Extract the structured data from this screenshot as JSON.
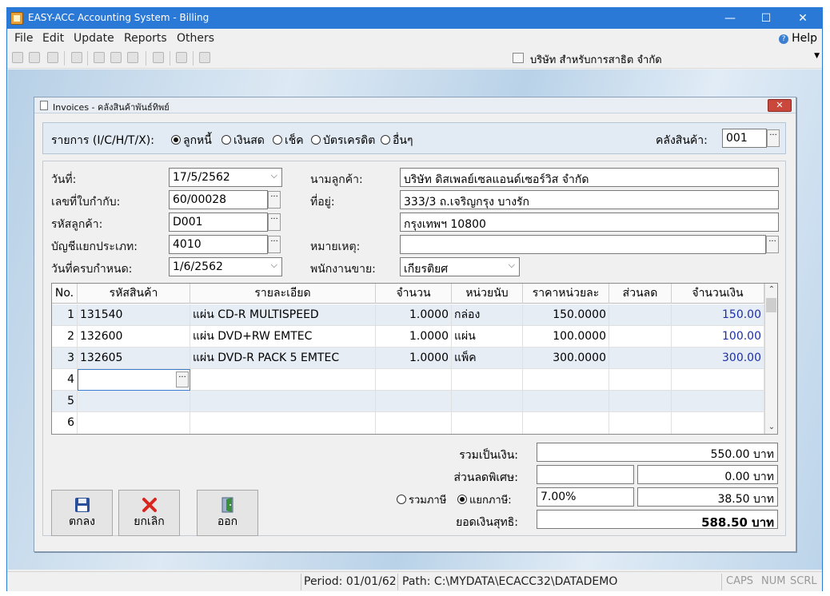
{
  "window": {
    "title": "EASY-ACC Accounting System - Billing",
    "minimize": "—",
    "maximize": "☐",
    "close": "✕"
  },
  "menu": {
    "file": "File",
    "edit": "Edit",
    "update": "Update",
    "reports": "Reports",
    "others": "Others",
    "help": "Help"
  },
  "toolbar": {
    "company": "บริษัท สำหรับการสาธิต จำกัด"
  },
  "dialog": {
    "title": "Invoices - คลังสินค้าพันธ์ทิพย์",
    "type_label": "รายการ (I/C/H/T/X):",
    "types": [
      {
        "label": "ลูกหนี้",
        "selected": true
      },
      {
        "label": "เงินสด",
        "selected": false
      },
      {
        "label": "เช็ค",
        "selected": false
      },
      {
        "label": "บัตรเครดิต",
        "selected": false
      },
      {
        "label": "อื่นๆ",
        "selected": false
      }
    ],
    "warehouse_label": "คลังสินค้า:",
    "warehouse": "001"
  },
  "form": {
    "date_label": "วันที่:",
    "date": "17/5/2562",
    "invoice_label": "เลขที่ใบกำกับ:",
    "invoice": "60/00028",
    "customer_code_label": "รหัสลูกค้า:",
    "customer_code": "D001",
    "account_label": "บัญชีแยกประเภท:",
    "account": "4010",
    "due_label": "วันที่ครบกำหนด:",
    "due": "1/6/2562",
    "customer_name_label": "นามลูกค้า:",
    "customer_name": "บริษัท ดิสเพลย์เซลแอนด์เซอร์วิส จำกัด",
    "address_label": "ที่อยู่:",
    "address1": "333/3 ถ.เจริญกรุง บางรัก",
    "address2": "กรุงเทพฯ 10800",
    "remark_label": "หมายเหตุ:",
    "remark": "",
    "salesman_label": "พนักงานขาย:",
    "salesman": "เกียรติยศ"
  },
  "grid": {
    "headers": [
      "No.",
      "รหัสสินค้า",
      "รายละเอียด",
      "จำนวน",
      "หน่วยนับ",
      "ราคาหน่วยละ",
      "ส่วนลด",
      "จำนวนเงิน"
    ],
    "rows": [
      {
        "no": "1",
        "code": "131540",
        "desc": "แผ่น CD-R MULTISPEED",
        "qty": "1.0000",
        "unit": "กล่อง",
        "price": "150.0000",
        "disc": "",
        "amount": "150.00"
      },
      {
        "no": "2",
        "code": "132600",
        "desc": "แผ่น DVD+RW EMTEC",
        "qty": "1.0000",
        "unit": "แผ่น",
        "price": "100.0000",
        "disc": "",
        "amount": "100.00"
      },
      {
        "no": "3",
        "code": "132605",
        "desc": "แผ่น DVD-R PACK 5 EMTEC",
        "qty": "1.0000",
        "unit": "แพ็ค",
        "price": "300.0000",
        "disc": "",
        "amount": "300.00"
      },
      {
        "no": "4",
        "code": "",
        "desc": "",
        "qty": "",
        "unit": "",
        "price": "",
        "disc": "",
        "amount": ""
      },
      {
        "no": "5",
        "code": "",
        "desc": "",
        "qty": "",
        "unit": "",
        "price": "",
        "disc": "",
        "amount": ""
      },
      {
        "no": "6",
        "code": "",
        "desc": "",
        "qty": "",
        "unit": "",
        "price": "",
        "disc": "",
        "amount": ""
      }
    ]
  },
  "totals": {
    "sum_label": "รวมเป็นเงิน:",
    "sum": "550.00 บาท",
    "discount_label": "ส่วนลดพิเศษ:",
    "discount_input": "",
    "discount": "0.00 บาท",
    "vat_include_label": "รวมภาษี",
    "vat_exclude_label": "แยกภาษี:",
    "vat_mode": "แยกภาษี",
    "vat_rate": "7.00%",
    "vat": "38.50 บาท",
    "net_label": "ยอดเงินสุทธิ:",
    "net": "588.50 บาท"
  },
  "buttons": {
    "ok": "ตกลง",
    "cancel": "ยกเลิก",
    "exit": "ออก"
  },
  "status": {
    "period": "Period: 01/01/62",
    "path": "Path: C:\\MYDATA\\ECACC32\\DATADEMO",
    "caps": "CAPS",
    "num": "NUM",
    "scrl": "SCRL"
  }
}
